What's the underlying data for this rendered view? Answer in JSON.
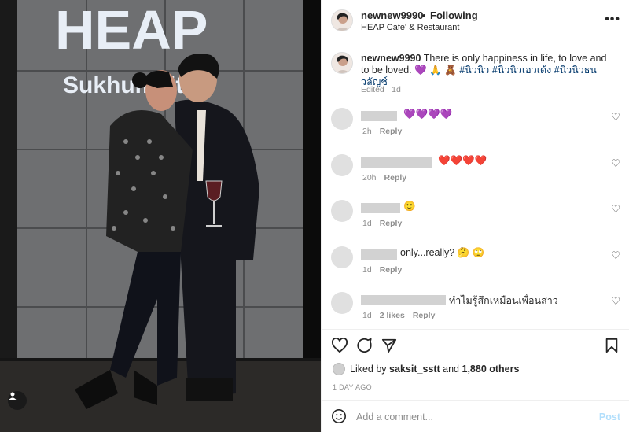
{
  "post_header": {
    "username": "newnew9990",
    "separator": "•",
    "follow_status": "Following",
    "location": "HEAP Cafe' & Restaurant",
    "more_icon": "more-horizontal-icon"
  },
  "photo": {
    "sign_line1": "HEAP",
    "sign_line2": "Sukhumvit 47"
  },
  "caption": {
    "username": "newnew9990",
    "text_before": "There is only happiness in life, to love and to be loved.",
    "emojis": "💜 🙏 🧸",
    "hashtags": [
      "#นิวนิว",
      "#นิวนิวเอวเด้ง",
      "#นิวนิวธนวลัญช์"
    ],
    "meta": "Edited · 1d"
  },
  "comments": [
    {
      "text": "",
      "emoji": "💜💜💜💜",
      "time": "2h",
      "likes": "",
      "reply": "Reply"
    },
    {
      "text": "",
      "emoji": "❤️❤️❤️❤️",
      "time": "20h",
      "likes": "",
      "reply": "Reply"
    },
    {
      "text": "",
      "emoji": "🙂",
      "time": "1d",
      "likes": "",
      "reply": "Reply"
    },
    {
      "text": "only...really?",
      "emoji": "🤔 🙄",
      "time": "1d",
      "likes": "",
      "reply": "Reply"
    },
    {
      "text": "ทำไมรู้สึกเหมือนเพื่อนสาว",
      "emoji": "",
      "time": "1d",
      "likes": "2 likes",
      "reply": "Reply"
    }
  ],
  "actions": {
    "like_icon": "heart-outline-icon",
    "comment_icon": "comment-bubble-icon",
    "share_icon": "paper-plane-icon",
    "save_icon": "bookmark-icon"
  },
  "likes": {
    "prefix": "Liked by",
    "user": "saksit_sstt",
    "and": "and",
    "others": "1,880 others"
  },
  "timestamp": "1 DAY AGO",
  "add_comment": {
    "placeholder": "Add a comment...",
    "post_label": "Post"
  },
  "colors": {
    "link": "#00376b",
    "meta": "#8e8e8e",
    "post_disabled": "#b2dffc",
    "heart_purple": "#8a5fd1",
    "heart_red": "#e0202a"
  }
}
